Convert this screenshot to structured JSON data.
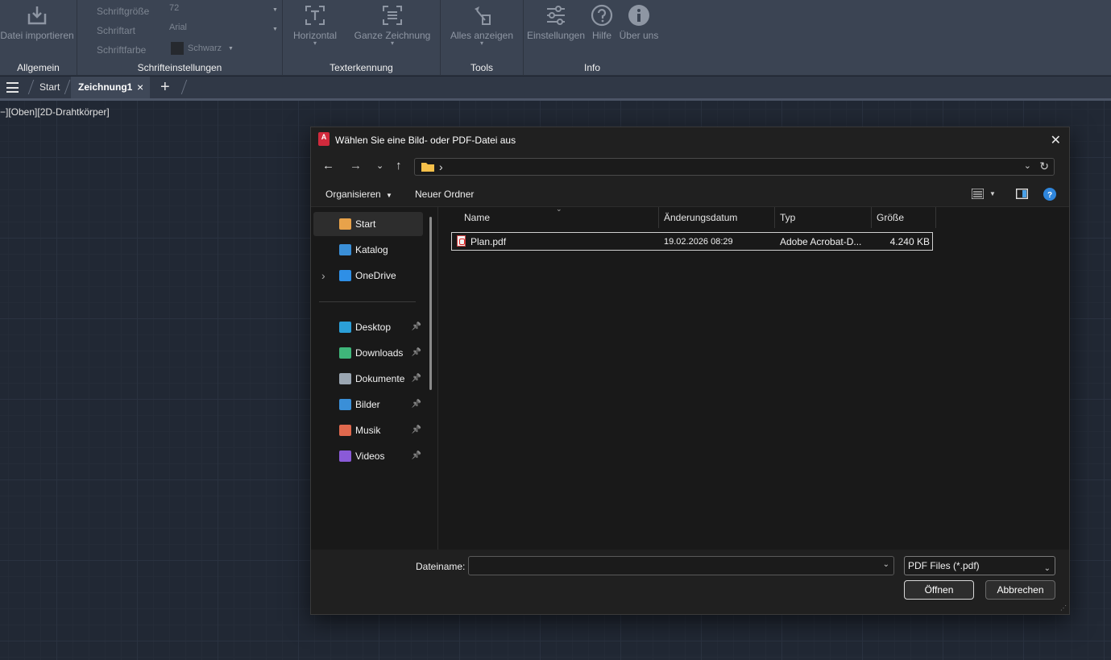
{
  "ribbon": {
    "allgemein": {
      "import_label": "Datei importieren",
      "group_label": "Allgemein"
    },
    "schrift": {
      "size_label": "Schriftgröße",
      "size_value": "72",
      "font_label": "Schriftart",
      "font_value": "Arial",
      "color_label": "Schriftfarbe",
      "color_value": "Schwarz",
      "group_label": "Schrifteinstellungen"
    },
    "texterkennung": {
      "horizontal_label": "Horizontal",
      "ganze_label": "Ganze Zeichnung",
      "group_label": "Texterkennung"
    },
    "tools": {
      "alles_label": "Alles anzeigen",
      "group_label": "Tools"
    },
    "info": {
      "einstellungen_label": "Einstellungen",
      "hilfe_label": "Hilfe",
      "ueber_label": "Über uns",
      "group_label": "Info"
    }
  },
  "tabs": {
    "start": "Start",
    "active": "Zeichnung1",
    "close": "×",
    "add": "+"
  },
  "viewport_label": "−][Oben][2D-Drahtkörper]",
  "dialog": {
    "app_icon_text": "A",
    "title": "Wählen Sie eine Bild- oder PDF-Datei aus",
    "close": "✕",
    "address_path": "›",
    "toolbar": {
      "organize": "Organisieren",
      "new_folder": "Neuer Ordner"
    },
    "sidebar": [
      {
        "label": "Start",
        "icon": "home-icon",
        "color": "#e8a24a"
      },
      {
        "label": "Katalog",
        "icon": "gallery-icon",
        "color": "#3a8fd8"
      },
      {
        "label": "OneDrive",
        "icon": "cloud-icon",
        "color": "#2e8fe6"
      },
      {
        "label": "Desktop",
        "icon": "desktop-icon",
        "color": "#2b9fd8",
        "pinned": true
      },
      {
        "label": "Downloads",
        "icon": "download-icon",
        "color": "#3fb67a",
        "pinned": true
      },
      {
        "label": "Dokumente",
        "icon": "document-icon",
        "color": "#9aa6b2",
        "pinned": true
      },
      {
        "label": "Bilder",
        "icon": "pictures-icon",
        "color": "#3a8fd8",
        "pinned": true
      },
      {
        "label": "Musik",
        "icon": "music-icon",
        "color": "#e0694e",
        "pinned": true
      },
      {
        "label": "Videos",
        "icon": "video-icon",
        "color": "#8a5ad8",
        "pinned": true
      }
    ],
    "columns": {
      "name": "Name",
      "date": "Änderungsdatum",
      "type": "Typ",
      "size": "Größe"
    },
    "files": [
      {
        "name": "Plan.pdf",
        "date": "19.02.2026 08:29",
        "type": "Adobe Acrobat-D...",
        "size": "4.240 KB"
      }
    ],
    "footer": {
      "filename_label": "Dateiname:",
      "filename_value": "",
      "filter": "PDF Files (*.pdf)",
      "open": "Öffnen",
      "cancel": "Abbrechen"
    }
  }
}
